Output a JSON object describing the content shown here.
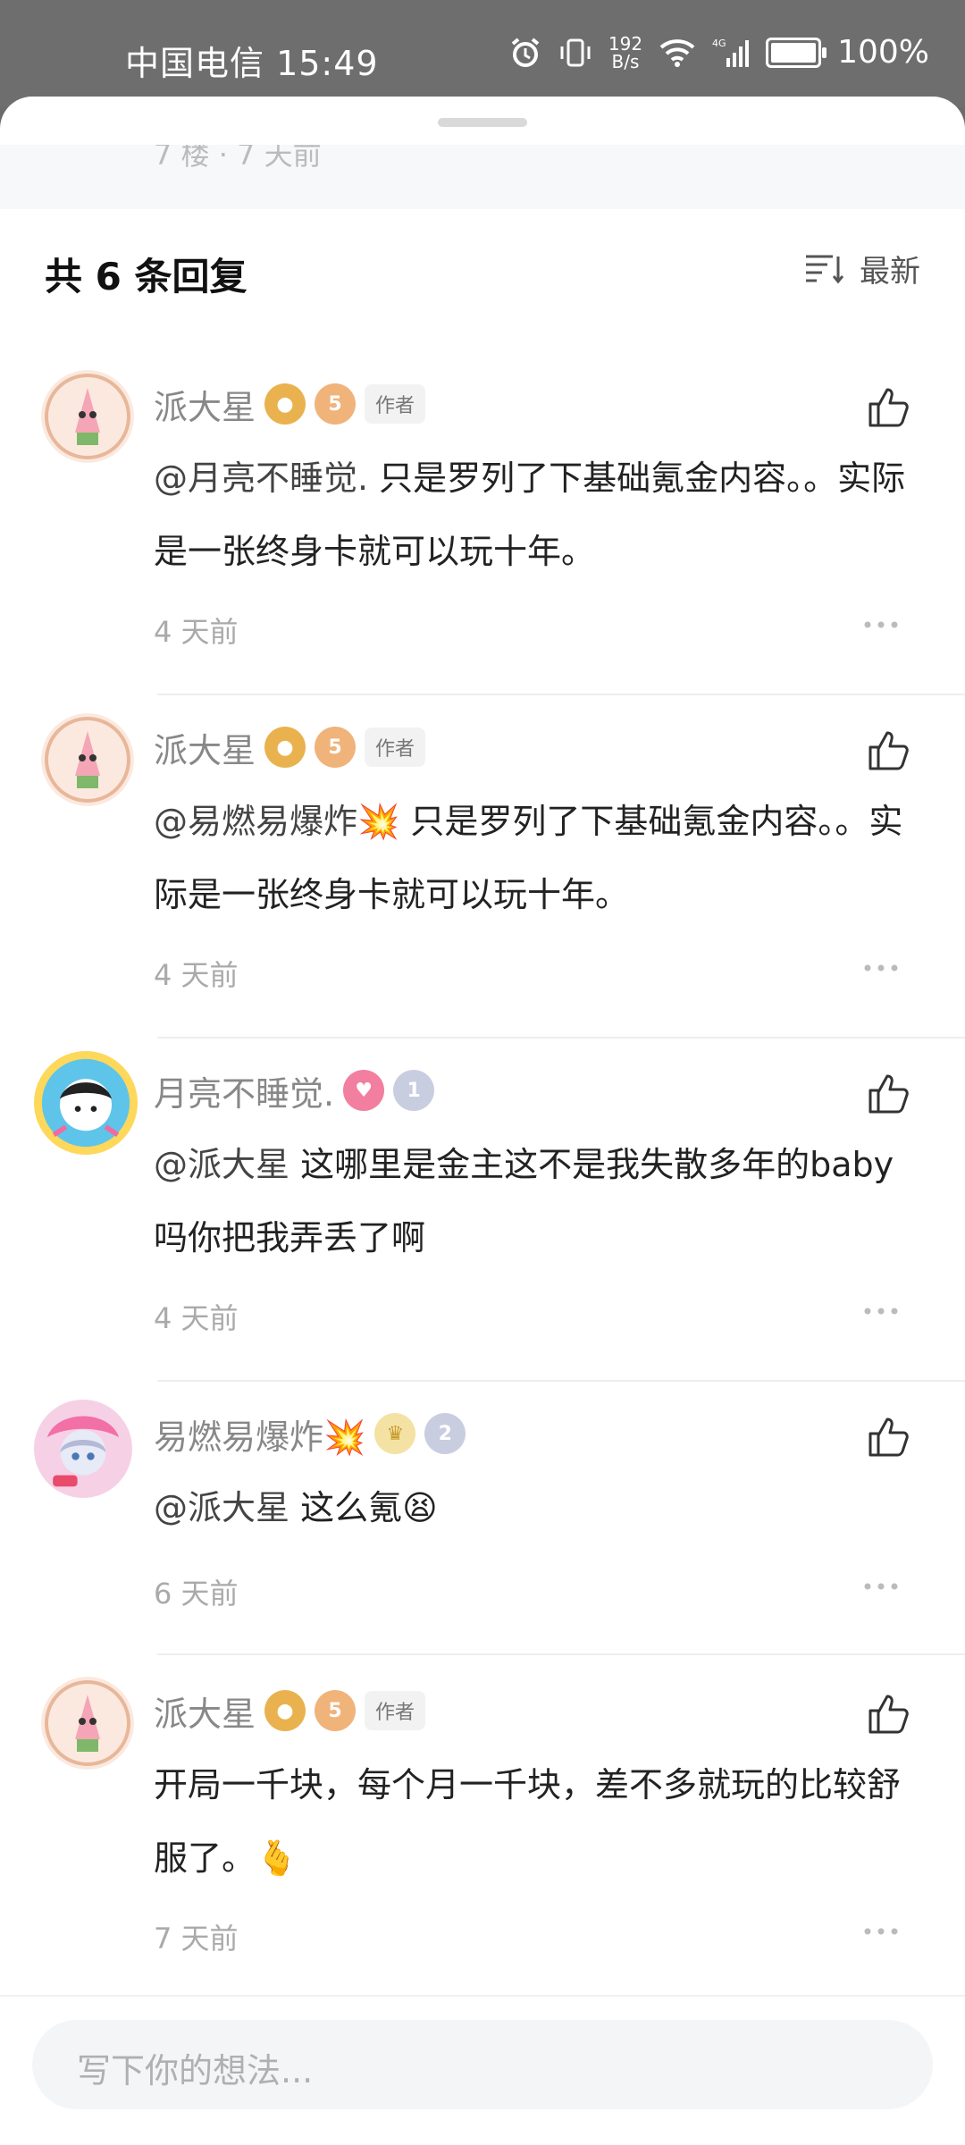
{
  "status_bar": {
    "carrier_time": "中国电信 15:49",
    "net_speed_value": "192",
    "net_speed_unit": "B/s",
    "battery": "100%",
    "icons": [
      "alarm-icon",
      "vibrate-icon",
      "wifi-icon",
      "signal-4g-icon",
      "battery-icon"
    ]
  },
  "peek_text": "7 楼 · 7 天前",
  "header": {
    "reply_count": "共 6 条回复",
    "sort_label": "最新"
  },
  "comments": [
    {
      "name": "派大星",
      "author_tag": "作者",
      "level": "5",
      "mention": "@月亮不睡觉.",
      "body": " 只是罗列了下基础氪金内容。。实际是一张终身卡就可以玩十年。",
      "time": "4 天前"
    },
    {
      "name": "派大星",
      "author_tag": "作者",
      "level": "5",
      "mention": "@易燃易爆炸💥",
      "body": " 只是罗列了下基础氪金内容。。实际是一张终身卡就可以玩十年。",
      "time": "4 天前"
    },
    {
      "name": "月亮不睡觉.",
      "level": "1",
      "mention": "@派大星",
      "body": " 这哪里是金主这不是我失散多年的baby吗你把我弄丢了啊",
      "time": "4 天前"
    },
    {
      "name": "易燃易爆炸💥",
      "level": "2",
      "mention": "@派大星",
      "body": " 这么氪😫",
      "time": "6 天前"
    },
    {
      "name": "派大星",
      "author_tag": "作者",
      "level": "5",
      "mention": "",
      "body": "开局一千块，每个月一千块，差不多就玩的比较舒服了。🫰",
      "time": "7 天前"
    }
  ],
  "input": {
    "placeholder": "写下你的想法..."
  },
  "colors": {
    "accent_author_badge": "#f0b37a",
    "level_badge_silver": "#c9cde0"
  }
}
